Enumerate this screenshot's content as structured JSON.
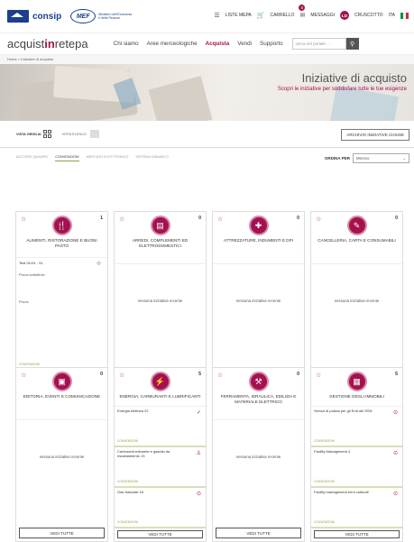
{
  "header": {
    "consip": "consip",
    "mef": "MEF",
    "mef_sub": "Ministero dell'Economia e delle Finanze",
    "util": {
      "lista_mepa": "LISTE MEPA",
      "carrello": "CARRELLO",
      "messaggi": "MESSAGGI",
      "messaggi_count": "0",
      "user_initials": "LD",
      "cruscotto": "CRUSCOTTO",
      "lang": "ITA"
    },
    "brand_a": "acquist",
    "brand_b": "in",
    "brand_c": "retepa",
    "nav": [
      "Chi siamo",
      "Aree merceologiche",
      "Acquista",
      "Vendi",
      "Supporto"
    ],
    "search_placeholder": "cerca nel portale ..."
  },
  "breadcrumb": "Home > Iniziative di acquisto",
  "hero": {
    "title": "Iniziative di acquisto",
    "subtitle": "Scopri le iniziative per soddisfare tutte le tue esigenze"
  },
  "view": {
    "grid": "VISTA GRIGLIA",
    "list": "VISTA ELENCO",
    "archive": "ARCHIVIO INIZIATIVE CHIUSE"
  },
  "filters": {
    "tabs": [
      "ACCORDI QUADRO",
      "CONVENZIONI",
      "MERCATO ELETTRONICO",
      "SISTEMA DINAMICO"
    ],
    "ordina": "ORDINA PER",
    "ordina_value": "Merceo"
  },
  "cards": [
    {
      "title": "ALIMENTI, RISTORAZIONE E BUONI PASTO",
      "count": "1",
      "icon": "food-icon",
      "glyph": "🍴"
    },
    {
      "title": "ARREDI, COMPLEMENTI ED ELETTRODOMESTICI",
      "count": "0",
      "icon": "appliance-icon",
      "glyph": "▤"
    },
    {
      "title": "ATTREZZATURE, INDUMENTI E DPI",
      "count": "0",
      "icon": "tools-icon",
      "glyph": "✚"
    },
    {
      "title": "CANCELLERIA, CARTA E CONSUMABILI",
      "count": "0",
      "icon": "stationery-icon",
      "glyph": "✎"
    },
    {
      "title": "EDITORIA, EVENTI E COMUNICAZIONE",
      "count": "0",
      "icon": "media-icon",
      "glyph": "▣"
    },
    {
      "title": "ENERGIA, CARBURANTI E LUBRIFICANTI",
      "count": "5",
      "icon": "energy-icon",
      "glyph": "⚡"
    },
    {
      "title": "FERRAMENTA, IDRAULICA, EDILIZIA E MATERIALE ELETTRICO",
      "count": "0",
      "icon": "hardware-icon",
      "glyph": "⚒"
    },
    {
      "title": "GESTIONE DEGLI IMMOBILI",
      "count": "5",
      "icon": "building-icon",
      "glyph": "▦"
    }
  ],
  "card1_item": {
    "title": "Test 01/24 - SL",
    "sub1": "Prova sottotitolo",
    "sub2": "Prova",
    "tag": "CONVENZIONI"
  },
  "card6_items": [
    {
      "title": "Energia elettrica 22",
      "tag": "CONVENZIONI",
      "mark": "✓"
    },
    {
      "title": "Carburanti extrarete e gasolio da riscaldamento 13",
      "tag": "CONVENZIONI",
      "mark": "♙"
    },
    {
      "title": "Gas Naturale 16",
      "tag": "CONVENZIONI",
      "mark": "⊙"
    }
  ],
  "card8_items": [
    {
      "title": "Servizi di pulizia per gli Enti del SSN",
      "tag": "CONVENZIONI",
      "mark": "⊙"
    },
    {
      "title": "Facility Management 4",
      "tag": "CONVENZIONI",
      "mark": "⊙"
    },
    {
      "title": "Facility management beni culturali",
      "tag": "CONVENZIONI",
      "mark": "⊙"
    }
  ],
  "empty": "nessuna iniziativa recente",
  "vedi": "VEDI TUTTE",
  "colors": {
    "accent": "#a3124e",
    "green": "#8ba646",
    "navy": "#1b3f8c"
  }
}
